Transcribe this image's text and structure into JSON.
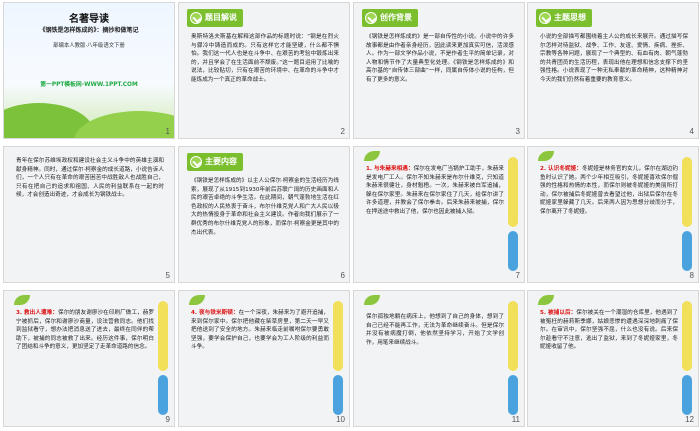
{
  "slides": [
    {
      "number": "1",
      "title": "名著导读",
      "subtitle": "《钢铁是怎样炼成的》：摘抄和做笔记",
      "grade": "部编本人教版·八年级语文下册",
      "watermark": "第一PPT模板网-WWW.1PPT.COM"
    },
    {
      "number": "2",
      "tag": "题目解说",
      "body": "奥斯特洛夫斯基在解释这部作品的标题时说：“钢是在烈火与骤冷中铸造而成的。只有这样它才能坚硬，什么都不惧怕。我们这一代人也是在斗争中、在艰苦的考验中锻炼出来的，并且学会了在生活面前不颓废。”这一题目运用了比喻的说法，比较贴切，只有在艰苦的环境中、在革命的斗争中才能炼成为一个真正的革命战士。"
    },
    {
      "number": "3",
      "tag": "创作背景",
      "body": "《钢铁是怎样炼成的》是一部自传性的小说。小说中的许多故事都是由作者亲身经历，因此读来更加真实可信，活泼感人。作为一部文学作品小说，不是作者生平的简单记录，对人物和情节作了大量典型化处理。《钢铁是怎样炼成的》和高尔基的“自传体三部曲”一样，同属自传体小说的佳构，但有了更多的意义。"
    },
    {
      "number": "4",
      "tag": "主题思想",
      "body": "小说的全部描写都围绕着主人公的成长来展开。通过描写保尔怎样对待监狱、战争、工作、友谊、爱情、疾病、挫折、宗教等各种问题，展现了一个典型的、有血有肉、朝气蓬勃的共青团员的生活历程，表现出他在理想和信念支撑下的坚强性格。小说表现了一种无私奉献的革命精神，这种精神对今天的我们仍然有着重要的教育意义。"
    },
    {
      "number": "5",
      "body": "青年在保尔苏维埃政权和建设社会主义斗争中的英雄主演和献身精神。同时，通过保尔·柯察金的成长道路，小说告诉人们，一个人只有在革命的艰苦困苦中战胜敌人也战胜自己，只有在把自己的追求和祖国、人民的利益联系在一起的时候，才会创造出奇迹，才会成长为钢铁战士。"
    },
    {
      "number": "6",
      "tag": "主要内容",
      "body": "《钢铁是怎样炼成的》以主人公保尔·柯察金的生活经历为线索，展现了从1915到1930年前后苏联广阔的历史画面和人民的艰苦卓绝的斗争生活。在此期间，朝气蓬勃地生活在红色政权的人民热衷于奋斗，布尔什维克党人和广大人民以极大的热情投身于革命和社会主义建设。作者向我们展示了一群优秀的布尔什维克党人的形象，而保尔·柯察金更是其中的杰出代表。"
    },
    {
      "number": "7",
      "body_red": "1. 与朱赫来相遇：",
      "body": "保尔在发电厂当锅炉工助手，朱赫来是发电厂工人。保尔不知朱赫来是布尔什维克，只知道朱赫来很健壮，身材魁梧。一次，朱赫来被白军追捕，躲在保尔家里。朱赫来在保尔家住了几天，给保尔讲了许多道理，并教会了保尔拳击。后来朱赫来被捕，保尔在押送途中救出了他，保尔也因此被捕入狱。"
    },
    {
      "number": "8",
      "body_red": "2. 认识冬妮娅：",
      "body": "冬妮娅是林务官的女儿，保尔在湖边钓鱼时认识了她。两个少年相互吸引，冬妮娅喜欢保尔倔强的性格和热情的本性，而保尔则被冬妮娅的美丽所打动，保尔被捕后冬妮娅曾去看望过他，出狱后保尔在冬妮娅家里躲藏了几天。后来两人因为思想分歧而分手，保尔离开了冬妮娅。"
    },
    {
      "number": "9",
      "body_red": "3. 救出人遭难：",
      "body": "保尔的朋友谢廖沙在印刷厂做工，赫罗宁被抓后，保尔和谢廖沙商量，设法营救同志。他们找到监狱看守，想办法把消息送了进去，最终在同伴的帮助下，被捕的同志被救了出来。经历这件事，保尔明白了团结和斗争的意义，更加坚定了走革命道路的信念。"
    },
    {
      "number": "10",
      "body_red": "4. 夜与铁米斯顿：",
      "body": "在一个深夜，朱赫来为了避开追捕，来到保尔家中。保尔把他藏在柴草房里，第二天一早又把他送到了安全的地方。朱赫来临走前嘱咐保尔要勇敢坚强，要学会保护自己，也要学会为工人阶级的利益而斗争。"
    },
    {
      "number": "11",
      "body": "保尔孤独地躺在病床上，他想到了自己的身体，想到了自己已经不能再工作，无法为革命继续奋斗。但是保尔并没有被病魔打倒，他依然坚持学习，开始了文学创作，用笔来继续战斗。"
    },
    {
      "number": "12",
      "body_red": "5. 被捕以后：",
      "body": "保尔被关在一个潮湿的仓库里，他遇到了被冤枉的赫莉斯季娜，姑娘悲惨的遭遇深深地刺痛了保尔。在审讯中，保尔坚强不屈，什么也没有说。后来保尔趁看守不注意，逃出了监狱，来到了冬妮娅家里，冬妮娅收留了他。"
    }
  ]
}
